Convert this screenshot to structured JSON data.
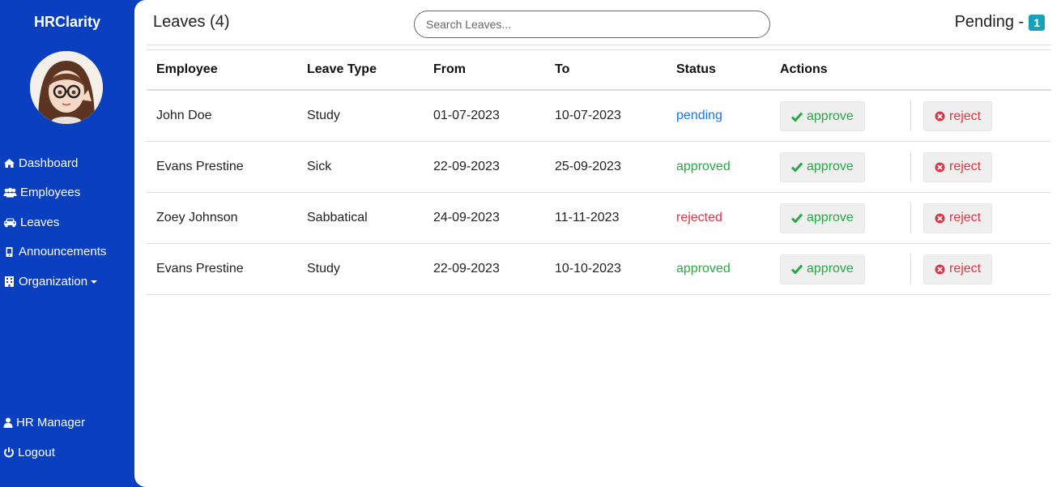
{
  "sidebar": {
    "brand": "HRClarity",
    "nav": [
      {
        "label": "Dashboard",
        "icon": "home-icon"
      },
      {
        "label": "Employees",
        "icon": "users-icon"
      },
      {
        "label": "Leaves",
        "icon": "car-icon"
      },
      {
        "label": "Announcements",
        "icon": "mobile-icon"
      },
      {
        "label": "Organization",
        "icon": "building-icon"
      }
    ],
    "user": {
      "label": "HR Manager",
      "icon": "user-icon"
    },
    "logout": {
      "label": "Logout",
      "icon": "power-icon"
    }
  },
  "header": {
    "title": "Leaves (4)",
    "search_placeholder": "Search Leaves...",
    "pending_label": "Pending -",
    "pending_count": "1"
  },
  "table": {
    "columns": [
      "Employee",
      "Leave Type",
      "From",
      "To",
      "Status",
      "Actions"
    ],
    "rows": [
      {
        "employee": "John Doe",
        "type": "Study",
        "from": "01-07-2023",
        "to": "10-07-2023",
        "status": "pending"
      },
      {
        "employee": "Evans Prestine",
        "type": "Sick",
        "from": "22-09-2023",
        "to": "25-09-2023",
        "status": "approved"
      },
      {
        "employee": "Zoey Johnson",
        "type": "Sabbatical",
        "from": "24-09-2023",
        "to": "11-11-2023",
        "status": "rejected"
      },
      {
        "employee": "Evans Prestine",
        "type": "Study",
        "from": "22-09-2023",
        "to": "10-10-2023",
        "status": "approved"
      }
    ],
    "approve_label": "approve",
    "reject_label": "reject"
  },
  "colors": {
    "sidebar": "#0a3fc0",
    "pending": "#1a73e8",
    "approved": "#28a745",
    "rejected": "#dc3545",
    "badge": "#17a2b8"
  }
}
